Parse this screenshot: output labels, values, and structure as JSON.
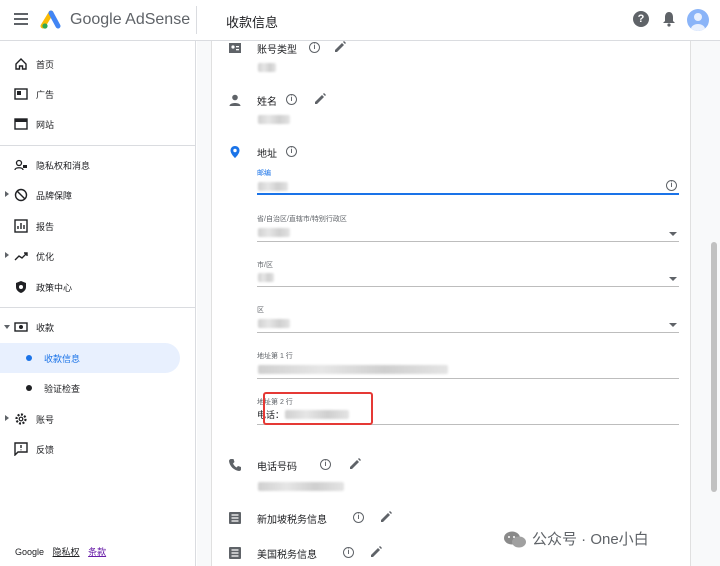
{
  "header": {
    "brand_google": "Google",
    "brand_product": "AdSense",
    "page_title": "收款信息",
    "help_glyph": "?"
  },
  "sidebar": {
    "items": [
      {
        "label": "首页",
        "icon": "home-icon"
      },
      {
        "label": "广告",
        "icon": "ads-icon"
      },
      {
        "label": "网站",
        "icon": "sites-icon"
      },
      {
        "label": "隐私权和消息",
        "icon": "privacy-messaging-icon"
      },
      {
        "label": "品牌保障",
        "icon": "block-icon"
      },
      {
        "label": "报告",
        "icon": "reports-icon"
      },
      {
        "label": "优化",
        "icon": "trending-icon"
      },
      {
        "label": "政策中心",
        "icon": "policy-shield-icon"
      },
      {
        "label": "收款",
        "icon": "payments-icon"
      },
      {
        "label": "收款信息"
      },
      {
        "label": "验证检查"
      },
      {
        "label": "账号",
        "icon": "gear-icon"
      },
      {
        "label": "反馈",
        "icon": "feedback-icon"
      }
    ],
    "footer": {
      "google": "Google",
      "privacy": "隐私权",
      "terms": "条款"
    }
  },
  "content": {
    "account_type_label": "账号类型",
    "name_label": "姓名",
    "address_label": "地址",
    "fields": {
      "postal_code": "邮编",
      "province": "省/自治区/直辖市/特别行政区",
      "city": "市/区",
      "district": "区",
      "address_line1": "地址第 1 行",
      "address_line2": "地址第 2 行",
      "address_line2_value": "电话："
    },
    "phone_label": "电话号码",
    "sg_tax_label": "新加坡税务信息",
    "us_tax_label": "美国税务信息",
    "info_glyph": "i"
  },
  "watermark": {
    "text": "公众号 · One小白"
  },
  "colors": {
    "accent": "#1a73e8",
    "highlight": "#e53935",
    "active_bg": "#e8f0fe"
  }
}
